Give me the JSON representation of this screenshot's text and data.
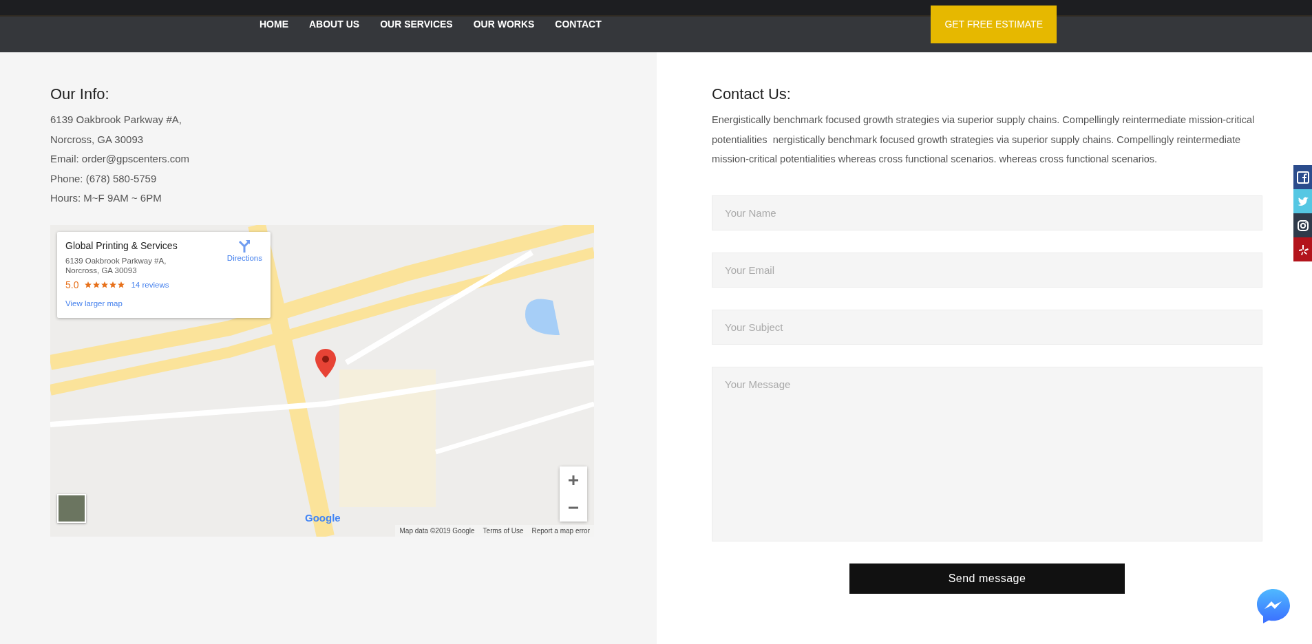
{
  "nav": {
    "items": [
      {
        "label": "HOME"
      },
      {
        "label": "ABOUT US"
      },
      {
        "label": "OUR SERVICES"
      },
      {
        "label": "OUR WORKS"
      },
      {
        "label": "CONTACT"
      }
    ],
    "cta": "GET FREE ESTIMATE"
  },
  "info": {
    "title": "Our Info:",
    "lines": [
      "6139 Oakbrook Parkway #A,",
      "Norcross, GA 30093",
      "Email: order@gpscenters.com",
      "Phone: (678) 580-5759",
      "Hours: M~F 9AM ~ 6PM"
    ]
  },
  "map": {
    "card": {
      "name": "Global Printing & Services",
      "address_lines": [
        "6139 Oakbrook Parkway #A,",
        "Norcross, GA 30093"
      ],
      "rating": "5.0",
      "stars": 5,
      "reviews": "14 reviews",
      "directions": "Directions",
      "larger_map": "View larger map"
    },
    "google_logo": "Google",
    "attribution": [
      "Map data ©2019 Google",
      "Terms of Use",
      "Report a map error"
    ]
  },
  "contact": {
    "title": "Contact Us:",
    "text": "Energistically benchmark focused growth strategies via superior supply chains. Compellingly reintermediate mission-critical potentialities  nergistically benchmark focused growth strategies via superior supply chains. Compellingly reintermediate mission-critical potentialities whereas cross functional scenarios. whereas cross functional scenarios.",
    "fields": [
      {
        "kind": "input",
        "placeholder": "Your Name"
      },
      {
        "kind": "input",
        "placeholder": "Your Email"
      },
      {
        "kind": "input",
        "placeholder": "Your Subject"
      },
      {
        "kind": "textarea",
        "placeholder": "Your Message"
      }
    ],
    "submit": "Send message"
  },
  "social": [
    {
      "kind": "facebook",
      "color": "#2b4c8c"
    },
    {
      "kind": "twitter",
      "color": "#55c7e3"
    },
    {
      "kind": "instagram",
      "color": "#2f3a4a"
    },
    {
      "kind": "yelp",
      "color": "#b3141c"
    }
  ]
}
